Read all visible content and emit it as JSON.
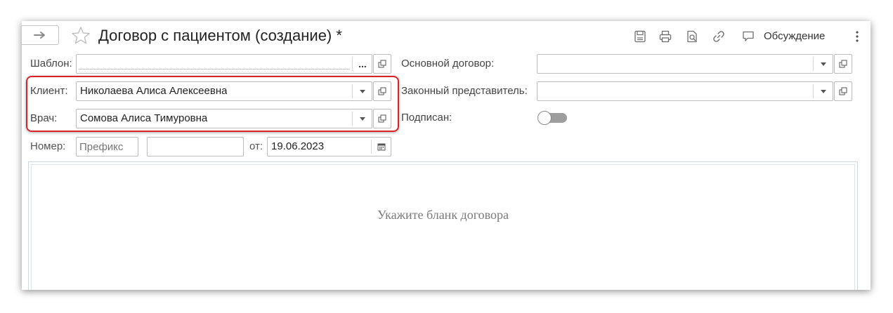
{
  "header": {
    "title": "Договор с пациентом (создание) *",
    "discuss_label": "Обсуждение",
    "icons": [
      "forward-arrow-icon",
      "star-icon",
      "save-icon",
      "print-icon",
      "preview-icon",
      "link-icon",
      "discussion-icon",
      "more-icon"
    ]
  },
  "form": {
    "template": {
      "label": "Шаблон:",
      "value": ""
    },
    "client": {
      "label": "Клиент:",
      "value": "Николаева Алиса Алексеевна"
    },
    "doctor": {
      "label": "Врач:",
      "value": "Сомова Алиса Тимуровна"
    },
    "number": {
      "label": "Номер:",
      "prefix_placeholder": "Префикс",
      "value": ""
    },
    "date": {
      "label": "от:",
      "value": "19.06.2023"
    },
    "main_contract": {
      "label": "Основной договор:",
      "value": ""
    },
    "legal_rep": {
      "label": "Законный представитель:",
      "value": ""
    },
    "signed": {
      "label": "Подписан:",
      "on": false
    }
  },
  "content": {
    "hint": "Укажите бланк договора"
  },
  "colors": {
    "highlight": "#d9222a",
    "border": "#bdbdbd",
    "toggle_track": "#9e9e9e"
  }
}
